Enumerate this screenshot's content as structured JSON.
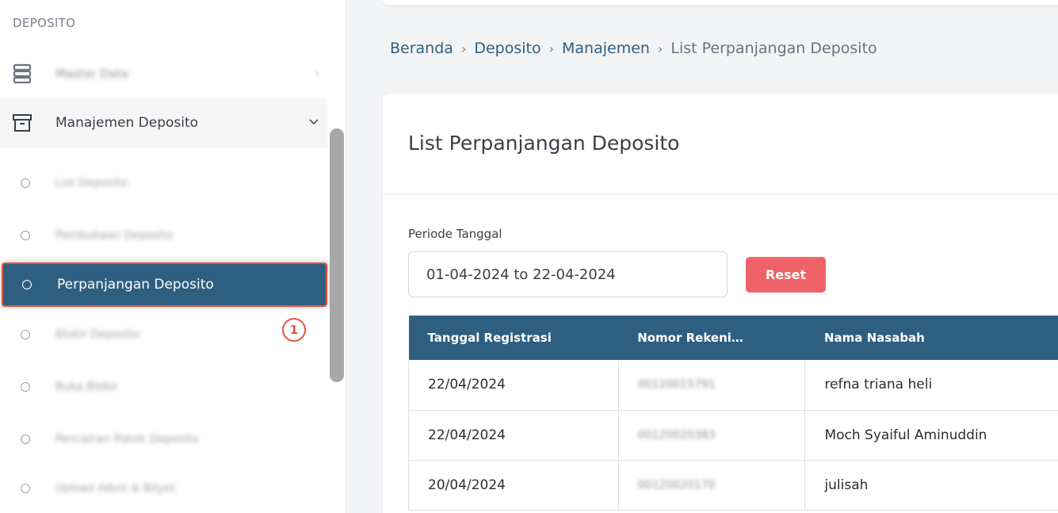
{
  "sidebar": {
    "section_label": "DEPOSITO",
    "master": {
      "label": "Master Data",
      "chevron": "›"
    },
    "manajemen": {
      "label": "Manajemen Deposito",
      "chevron": "⌄"
    },
    "submenu": [
      {
        "label": "List Deposito"
      },
      {
        "label": "Pembukaan Deposito"
      },
      {
        "label": "Perpanjangan Deposito"
      },
      {
        "label": "Blokir Deposito"
      },
      {
        "label": "Buka Blokir"
      },
      {
        "label": "Pencairan Pokok Deposito"
      },
      {
        "label": "Upload Advis & Bilyet"
      }
    ],
    "step_badge": "1"
  },
  "breadcrumb": {
    "items": [
      "Beranda",
      "Deposito",
      "Manajemen",
      "List Perpanjangan Deposito"
    ],
    "separator": "›"
  },
  "card": {
    "title": "List Perpanjangan Deposito",
    "period_label": "Periode Tanggal",
    "date_range": "01-04-2024 to 22-04-2024",
    "reset_label": "Reset"
  },
  "table": {
    "headers": [
      "Tanggal Registrasi",
      "Nomor Rekeni…",
      "Nama Nasabah"
    ],
    "rows": [
      {
        "tanggal": "22/04/2024",
        "nomor": "00120015791",
        "nama": "refna triana heli"
      },
      {
        "tanggal": "22/04/2024",
        "nomor": "00120020383",
        "nama": "Moch Syaiful Aminuddin"
      },
      {
        "tanggal": "20/04/2024",
        "nomor": "00120020170",
        "nama": "julisah"
      }
    ]
  },
  "colors": {
    "primary": "#2f5f80",
    "reset": "#ef6368",
    "highlight": "#e5533d"
  }
}
